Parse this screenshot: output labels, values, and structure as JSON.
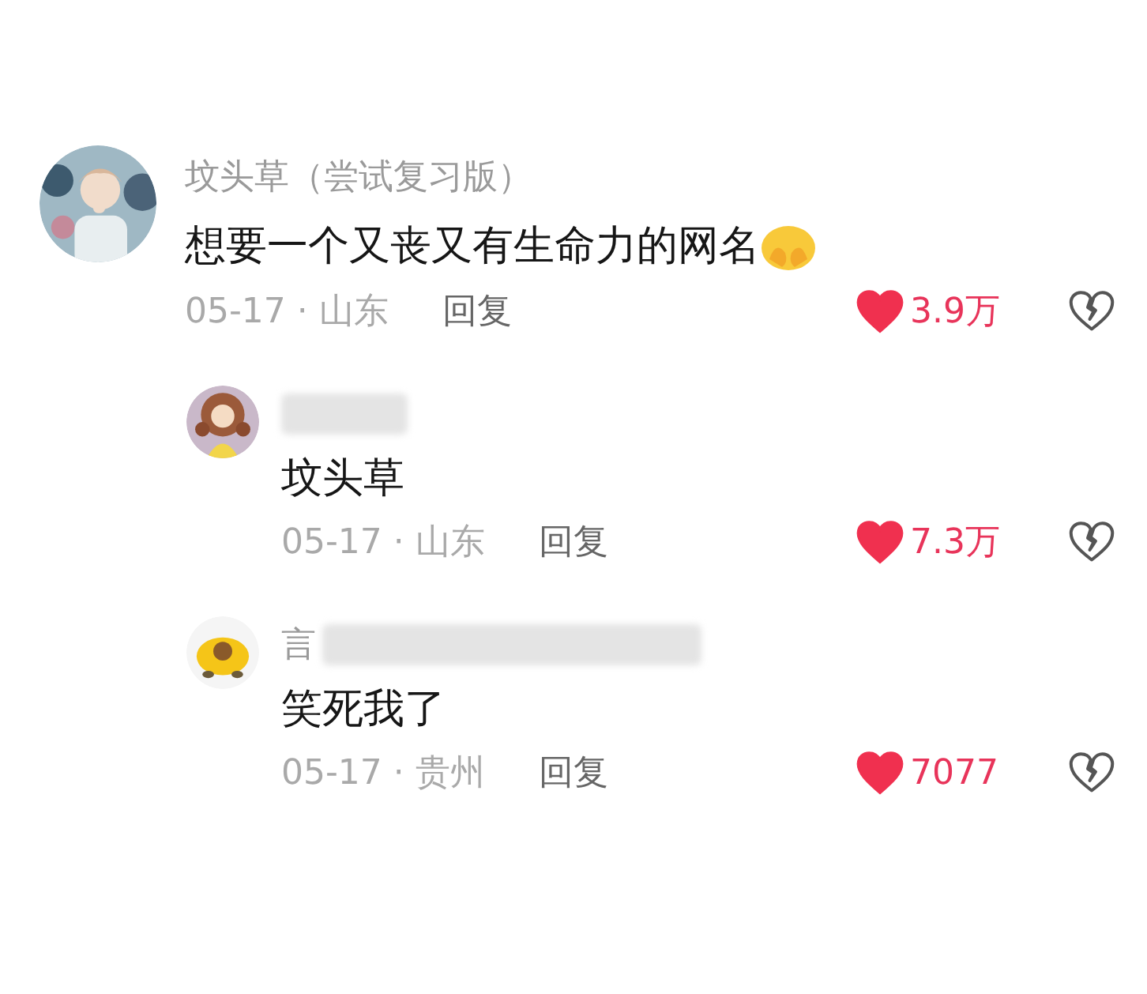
{
  "comment": {
    "author": "坟头草（尝试复习版）",
    "text": "想要一个又丧又有生命力的网名",
    "date": "05-17 · 山东",
    "reply_label": "回复",
    "likes": "3.9万",
    "liked": true,
    "replies": [
      {
        "author_blurred": true,
        "text": "坟头草",
        "date": "05-17 · 山东",
        "reply_label": "回复",
        "likes": "7.3万",
        "liked": true
      },
      {
        "author": "言",
        "author_blurred": true,
        "text": "笑死我了",
        "date": "05-17 · 贵州",
        "reply_label": "回复",
        "likes": "7077",
        "liked": true
      }
    ]
  }
}
